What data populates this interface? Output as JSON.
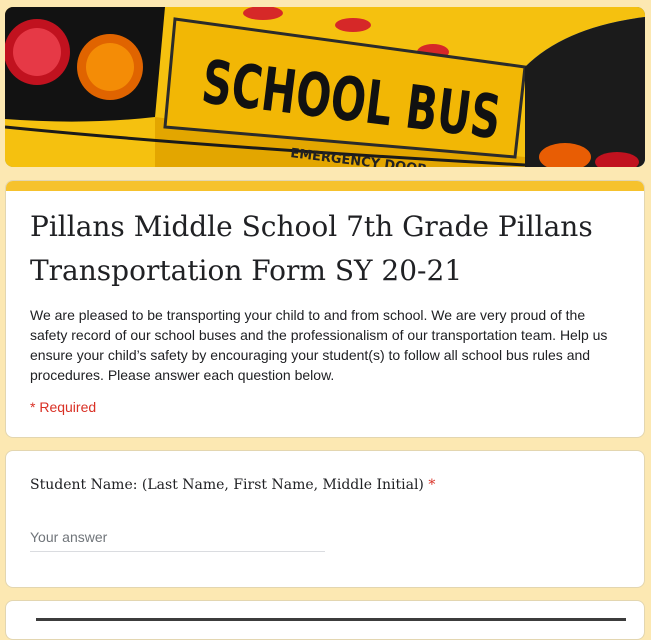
{
  "banner": {
    "sign_text": "SCHOOL BUS",
    "sub_text": "EMERGENCY DOOR"
  },
  "form": {
    "title": "Pillans Middle School 7th Grade Pillans Transportation Form SY 20-21",
    "description": "We are pleased to be transporting your child to and from school. We are very proud of the safety record of our school buses and the professionalism of our transportation team. Help us ensure your child’s safety by encouraging your student(s) to follow all school bus rules and procedures.  Please answer each question below.",
    "required_note": "* Required"
  },
  "question1": {
    "label": "Student Name: (Last Name, First Name, Middle Initial)",
    "required_mark": "*",
    "placeholder": "Your answer"
  },
  "colors": {
    "page_bg": "#fce8b2",
    "accent": "#f6c22d",
    "required": "#d93025"
  }
}
